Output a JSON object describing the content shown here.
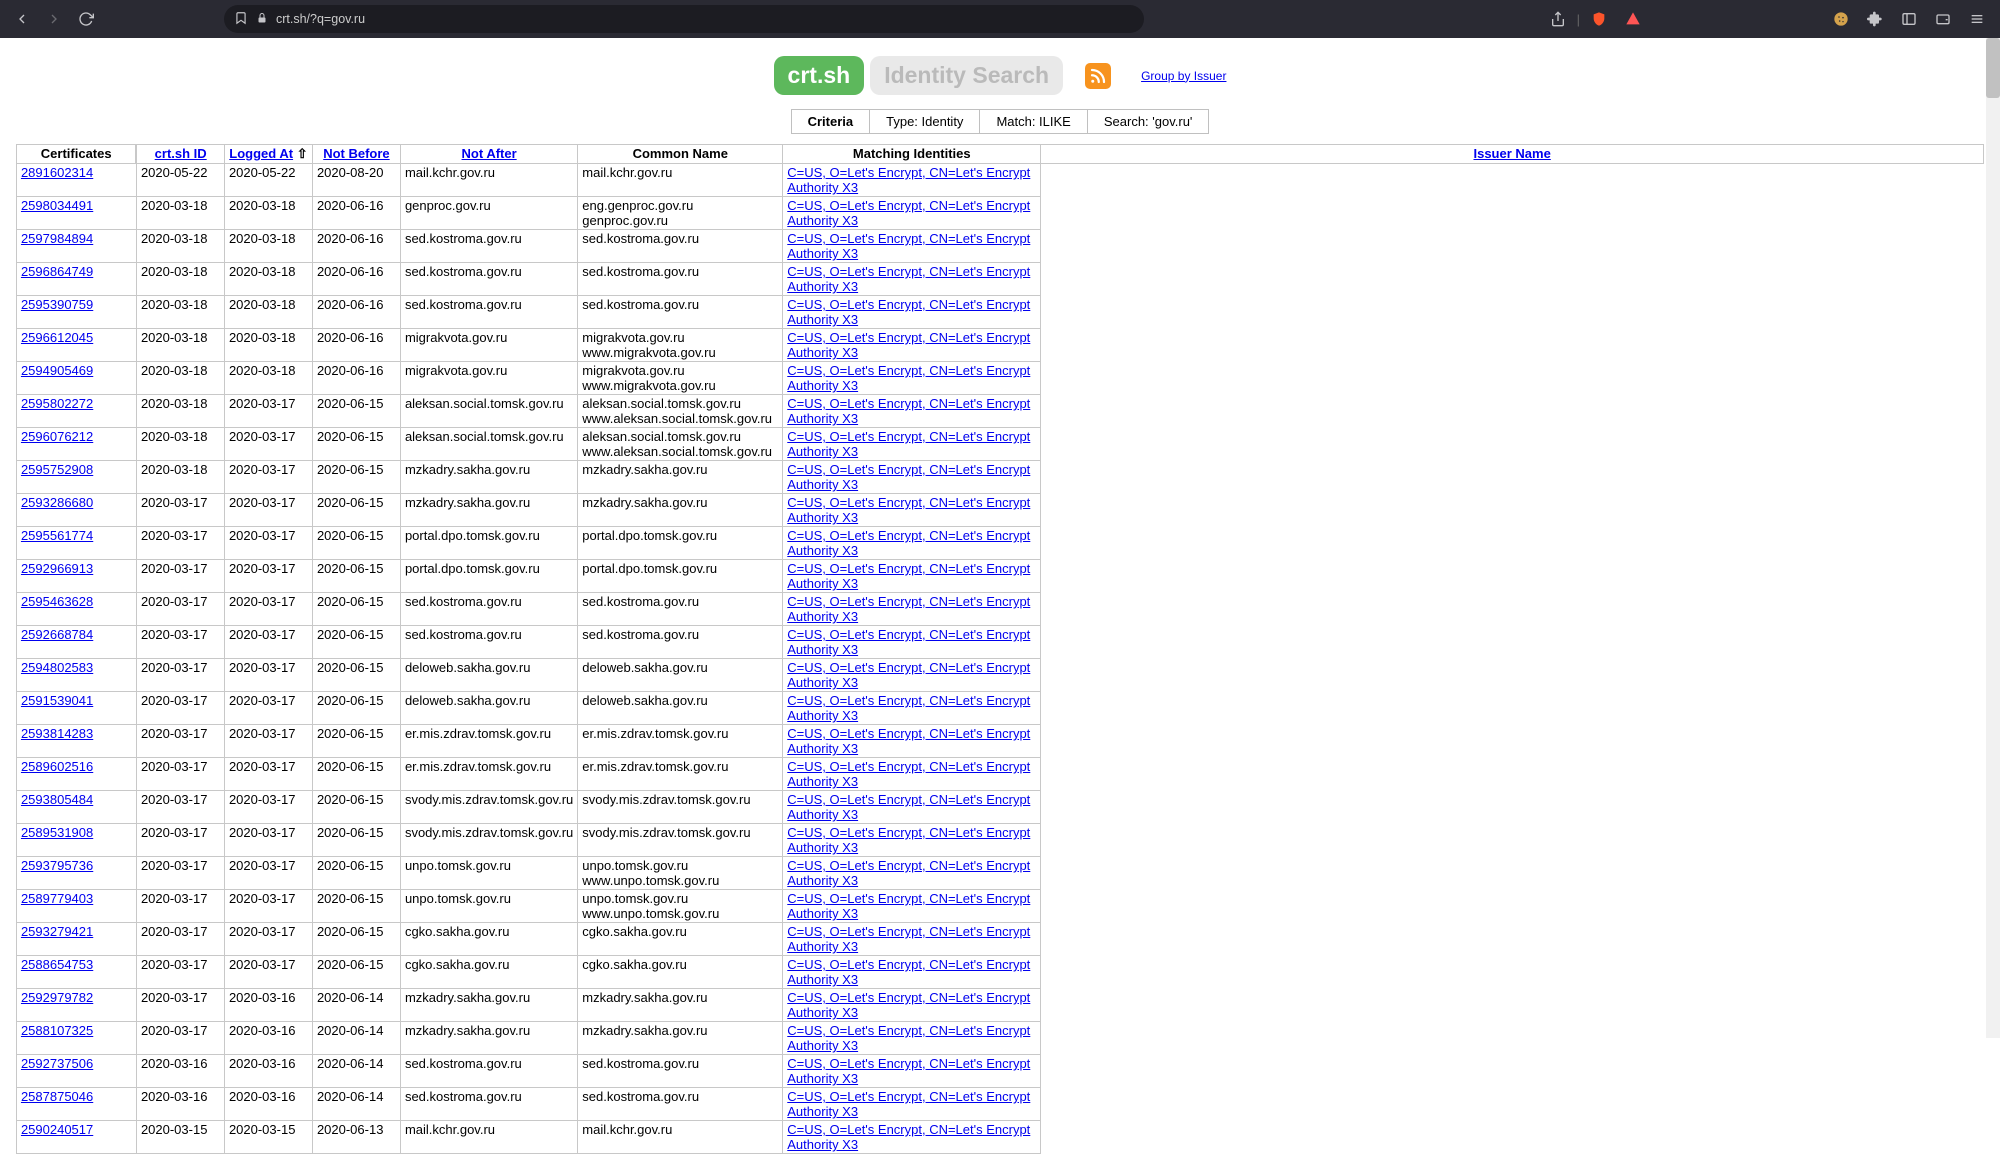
{
  "browser": {
    "url": "crt.sh/?q=gov.ru"
  },
  "header": {
    "logo1": "crt.sh",
    "logo2": "Identity Search",
    "group_link": "Group by Issuer"
  },
  "criteria": {
    "label": "Criteria",
    "type": "Type: Identity",
    "match": "Match: ILIKE",
    "search": "Search: 'gov.ru'"
  },
  "section_label": "Certificates",
  "columns": {
    "id": "crt.sh ID",
    "logged": "Logged At",
    "sort_indicator": "⇧",
    "not_before": "Not Before",
    "not_after": "Not After",
    "cn": "Common Name",
    "mi": "Matching Identities",
    "issuer": "Issuer Name"
  },
  "issuer_le": "C=US, O=Let's Encrypt, CN=Let's Encrypt Authority X3",
  "rows": [
    {
      "id": "2891602314",
      "logged": "2020-05-22",
      "nb": "2020-05-22",
      "na": "2020-08-20",
      "cn": "mail.kchr.gov.ru",
      "mi": "mail.kchr.gov.ru",
      "issuer_key": "le"
    },
    {
      "id": "2598034491",
      "logged": "2020-03-18",
      "nb": "2020-03-18",
      "na": "2020-06-16",
      "cn": "genproc.gov.ru",
      "mi": "eng.genproc.gov.ru\ngenproc.gov.ru",
      "issuer_key": "le"
    },
    {
      "id": "2597984894",
      "logged": "2020-03-18",
      "nb": "2020-03-18",
      "na": "2020-06-16",
      "cn": "sed.kostroma.gov.ru",
      "mi": "sed.kostroma.gov.ru",
      "issuer_key": "le"
    },
    {
      "id": "2596864749",
      "logged": "2020-03-18",
      "nb": "2020-03-18",
      "na": "2020-06-16",
      "cn": "sed.kostroma.gov.ru",
      "mi": "sed.kostroma.gov.ru",
      "issuer_key": "le"
    },
    {
      "id": "2595390759",
      "logged": "2020-03-18",
      "nb": "2020-03-18",
      "na": "2020-06-16",
      "cn": "sed.kostroma.gov.ru",
      "mi": "sed.kostroma.gov.ru",
      "issuer_key": "le"
    },
    {
      "id": "2596612045",
      "logged": "2020-03-18",
      "nb": "2020-03-18",
      "na": "2020-06-16",
      "cn": "migrakvota.gov.ru",
      "mi": "migrakvota.gov.ru\nwww.migrakvota.gov.ru",
      "issuer_key": "le"
    },
    {
      "id": "2594905469",
      "logged": "2020-03-18",
      "nb": "2020-03-18",
      "na": "2020-06-16",
      "cn": "migrakvota.gov.ru",
      "mi": "migrakvota.gov.ru\nwww.migrakvota.gov.ru",
      "issuer_key": "le"
    },
    {
      "id": "2595802272",
      "logged": "2020-03-18",
      "nb": "2020-03-17",
      "na": "2020-06-15",
      "cn": "aleksan.social.tomsk.gov.ru",
      "mi": "aleksan.social.tomsk.gov.ru\nwww.aleksan.social.tomsk.gov.ru",
      "issuer_key": "le"
    },
    {
      "id": "2596076212",
      "logged": "2020-03-18",
      "nb": "2020-03-17",
      "na": "2020-06-15",
      "cn": "aleksan.social.tomsk.gov.ru",
      "mi": "aleksan.social.tomsk.gov.ru\nwww.aleksan.social.tomsk.gov.ru",
      "issuer_key": "le"
    },
    {
      "id": "2595752908",
      "logged": "2020-03-18",
      "nb": "2020-03-17",
      "na": "2020-06-15",
      "cn": "mzkadry.sakha.gov.ru",
      "mi": "mzkadry.sakha.gov.ru",
      "issuer_key": "le"
    },
    {
      "id": "2593286680",
      "logged": "2020-03-17",
      "nb": "2020-03-17",
      "na": "2020-06-15",
      "cn": "mzkadry.sakha.gov.ru",
      "mi": "mzkadry.sakha.gov.ru",
      "issuer_key": "le"
    },
    {
      "id": "2595561774",
      "logged": "2020-03-17",
      "nb": "2020-03-17",
      "na": "2020-06-15",
      "cn": "portal.dpo.tomsk.gov.ru",
      "mi": "portal.dpo.tomsk.gov.ru",
      "issuer_key": "le"
    },
    {
      "id": "2592966913",
      "logged": "2020-03-17",
      "nb": "2020-03-17",
      "na": "2020-06-15",
      "cn": "portal.dpo.tomsk.gov.ru",
      "mi": "portal.dpo.tomsk.gov.ru",
      "issuer_key": "le"
    },
    {
      "id": "2595463628",
      "logged": "2020-03-17",
      "nb": "2020-03-17",
      "na": "2020-06-15",
      "cn": "sed.kostroma.gov.ru",
      "mi": "sed.kostroma.gov.ru",
      "issuer_key": "le"
    },
    {
      "id": "2592668784",
      "logged": "2020-03-17",
      "nb": "2020-03-17",
      "na": "2020-06-15",
      "cn": "sed.kostroma.gov.ru",
      "mi": "sed.kostroma.gov.ru",
      "issuer_key": "le"
    },
    {
      "id": "2594802583",
      "logged": "2020-03-17",
      "nb": "2020-03-17",
      "na": "2020-06-15",
      "cn": "deloweb.sakha.gov.ru",
      "mi": "deloweb.sakha.gov.ru",
      "issuer_key": "le"
    },
    {
      "id": "2591539041",
      "logged": "2020-03-17",
      "nb": "2020-03-17",
      "na": "2020-06-15",
      "cn": "deloweb.sakha.gov.ru",
      "mi": "deloweb.sakha.gov.ru",
      "issuer_key": "le"
    },
    {
      "id": "2593814283",
      "logged": "2020-03-17",
      "nb": "2020-03-17",
      "na": "2020-06-15",
      "cn": "er.mis.zdrav.tomsk.gov.ru",
      "mi": "er.mis.zdrav.tomsk.gov.ru",
      "issuer_key": "le"
    },
    {
      "id": "2589602516",
      "logged": "2020-03-17",
      "nb": "2020-03-17",
      "na": "2020-06-15",
      "cn": "er.mis.zdrav.tomsk.gov.ru",
      "mi": "er.mis.zdrav.tomsk.gov.ru",
      "issuer_key": "le"
    },
    {
      "id": "2593805484",
      "logged": "2020-03-17",
      "nb": "2020-03-17",
      "na": "2020-06-15",
      "cn": "svody.mis.zdrav.tomsk.gov.ru",
      "mi": "svody.mis.zdrav.tomsk.gov.ru",
      "issuer_key": "le"
    },
    {
      "id": "2589531908",
      "logged": "2020-03-17",
      "nb": "2020-03-17",
      "na": "2020-06-15",
      "cn": "svody.mis.zdrav.tomsk.gov.ru",
      "mi": "svody.mis.zdrav.tomsk.gov.ru",
      "issuer_key": "le"
    },
    {
      "id": "2593795736",
      "logged": "2020-03-17",
      "nb": "2020-03-17",
      "na": "2020-06-15",
      "cn": "unpo.tomsk.gov.ru",
      "mi": "unpo.tomsk.gov.ru\nwww.unpo.tomsk.gov.ru",
      "issuer_key": "le"
    },
    {
      "id": "2589779403",
      "logged": "2020-03-17",
      "nb": "2020-03-17",
      "na": "2020-06-15",
      "cn": "unpo.tomsk.gov.ru",
      "mi": "unpo.tomsk.gov.ru\nwww.unpo.tomsk.gov.ru",
      "issuer_key": "le"
    },
    {
      "id": "2593279421",
      "logged": "2020-03-17",
      "nb": "2020-03-17",
      "na": "2020-06-15",
      "cn": "cgko.sakha.gov.ru",
      "mi": "cgko.sakha.gov.ru",
      "issuer_key": "le"
    },
    {
      "id": "2588654753",
      "logged": "2020-03-17",
      "nb": "2020-03-17",
      "na": "2020-06-15",
      "cn": "cgko.sakha.gov.ru",
      "mi": "cgko.sakha.gov.ru",
      "issuer_key": "le"
    },
    {
      "id": "2592979782",
      "logged": "2020-03-17",
      "nb": "2020-03-16",
      "na": "2020-06-14",
      "cn": "mzkadry.sakha.gov.ru",
      "mi": "mzkadry.sakha.gov.ru",
      "issuer_key": "le"
    },
    {
      "id": "2588107325",
      "logged": "2020-03-17",
      "nb": "2020-03-16",
      "na": "2020-06-14",
      "cn": "mzkadry.sakha.gov.ru",
      "mi": "mzkadry.sakha.gov.ru",
      "issuer_key": "le"
    },
    {
      "id": "2592737506",
      "logged": "2020-03-16",
      "nb": "2020-03-16",
      "na": "2020-06-14",
      "cn": "sed.kostroma.gov.ru",
      "mi": "sed.kostroma.gov.ru",
      "issuer_key": "le"
    },
    {
      "id": "2587875046",
      "logged": "2020-03-16",
      "nb": "2020-03-16",
      "na": "2020-06-14",
      "cn": "sed.kostroma.gov.ru",
      "mi": "sed.kostroma.gov.ru",
      "issuer_key": "le"
    },
    {
      "id": "2590240517",
      "logged": "2020-03-15",
      "nb": "2020-03-15",
      "na": "2020-06-13",
      "cn": "mail.kchr.gov.ru",
      "mi": "mail.kchr.gov.ru",
      "issuer_key": "le"
    }
  ]
}
